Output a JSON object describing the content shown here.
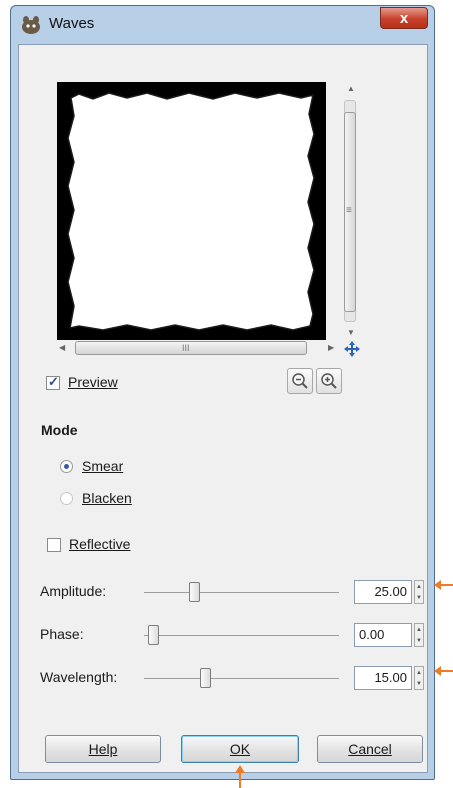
{
  "window": {
    "title": "Waves",
    "close_symbol": "x"
  },
  "scrollbar": {
    "h_thumb_grip": "III",
    "v_thumb_grip": "≡"
  },
  "preview": {
    "checkbox_label": "Preview",
    "checked": true
  },
  "mode": {
    "title": "Mode",
    "options": [
      {
        "label": "Smear",
        "selected": true
      },
      {
        "label": "Blacken",
        "selected": false
      }
    ]
  },
  "reflective": {
    "label": "Reflective",
    "checked": false
  },
  "params": {
    "amplitude": {
      "label": "Amplitude:",
      "value": "25.00"
    },
    "phase": {
      "label": "Phase:",
      "value": "0.00"
    },
    "wavelength": {
      "label": "Wavelength:",
      "value": "15.00"
    }
  },
  "buttons": {
    "help": "Help",
    "ok": "OK",
    "cancel": "Cancel"
  },
  "colors": {
    "annotation_arrow": "#ef7a2a",
    "title_bar": "#b8cfe8",
    "close_button": "#c8412c"
  }
}
